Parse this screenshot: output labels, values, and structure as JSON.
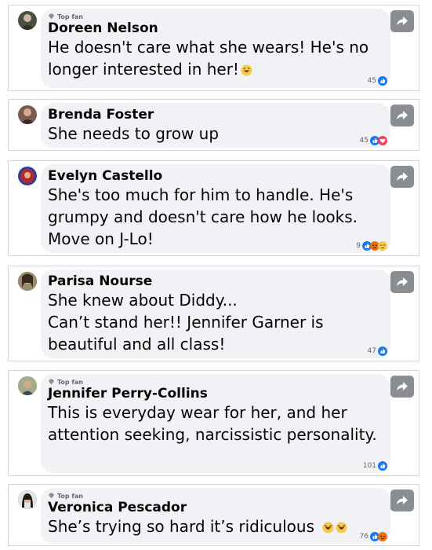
{
  "top_fan_label": "Top fan",
  "comments": [
    {
      "top_fan": true,
      "name": "Doreen Nelson",
      "lines": [
        "He doesn't care what she wears! He's no longer interested in her!"
      ],
      "emoji_tail": [
        "laughing-emoji"
      ],
      "count": "45",
      "reactions": [
        "like"
      ],
      "avatar_color": "#4a4f3e"
    },
    {
      "top_fan": false,
      "name": "Brenda Foster",
      "lines": [
        "She needs to grow up"
      ],
      "emoji_tail": [],
      "count": "45",
      "reactions": [
        "like",
        "love"
      ],
      "avatar_color": "#7a5b52"
    },
    {
      "top_fan": false,
      "name": "Evelyn Castello",
      "lines": [
        "She's too much for him to handle. He's grumpy and doesn't care how he looks. Move on J-Lo!"
      ],
      "emoji_tail": [],
      "count": "9",
      "reactions": [
        "like",
        "angry",
        "thinking"
      ],
      "avatar_color": "#2b3f9e"
    },
    {
      "top_fan": false,
      "name": "Parisa Nourse",
      "lines": [
        "She knew about Diddy...",
        "Can’t stand her!! Jennifer Garner is beautiful and all class!"
      ],
      "emoji_tail": [],
      "count": "47",
      "reactions": [
        "like"
      ],
      "avatar_color": "#6b5a4a"
    },
    {
      "top_fan": true,
      "name": "Jennifer Perry-Collins",
      "lines": [
        "This is everyday wear for her, and her attention seeking, narcissistic personality."
      ],
      "emoji_tail": [],
      "count": "101",
      "reactions": [
        "like"
      ],
      "avatar_color": "#7d8a5a"
    },
    {
      "top_fan": true,
      "name": "Veronica Pescador",
      "lines": [
        "She’s trying so hard it’s ridiculous"
      ],
      "emoji_tail": [
        "rofl-emoji",
        "rofl-emoji"
      ],
      "count": "76",
      "reactions": [
        "like",
        "angry"
      ],
      "avatar_color": "#2c2a28"
    }
  ],
  "colors": {
    "like": "#1877f2",
    "love": "#f33e58",
    "angry": "#e9710f",
    "bubble": "#f0f2f5",
    "share_button": "#8a8d91"
  }
}
